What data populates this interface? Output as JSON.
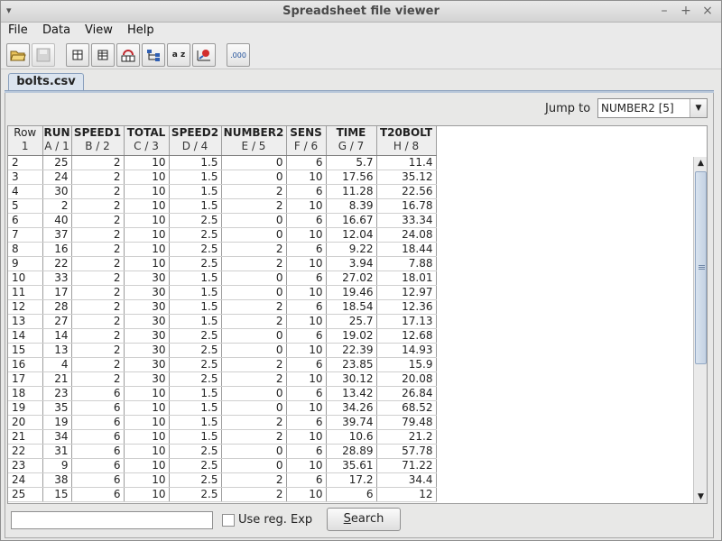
{
  "window": {
    "title": "Spreadsheet file viewer",
    "menu_glyph": "▾",
    "minimize": "–",
    "maximize": "+",
    "close": "×"
  },
  "menu": [
    {
      "label": "File"
    },
    {
      "label": "Data"
    },
    {
      "label": "View"
    },
    {
      "label": "Help"
    }
  ],
  "toolbar": {
    "buttons": [
      "open-folder-icon",
      "save-icon",
      "columns-icon",
      "rows-icon",
      "group-icon",
      "tree-icon",
      "sort-az-icon",
      "chart-icon",
      "decimal-format-icon"
    ],
    "sort_label": "a z",
    "decimal_label": ".000"
  },
  "tab": {
    "label": "bolts.csv"
  },
  "jump": {
    "label_pre": "J",
    "label_rest": "ump to",
    "selected": "NUMBER2 [5]"
  },
  "table": {
    "headers": [
      {
        "name": "Row",
        "sub": "1"
      },
      {
        "name": "RUN",
        "sub": "A / 1"
      },
      {
        "name": "SPEED1",
        "sub": "B / 2"
      },
      {
        "name": "TOTAL",
        "sub": "C / 3"
      },
      {
        "name": "SPEED2",
        "sub": "D / 4"
      },
      {
        "name": "NUMBER2",
        "sub": "E / 5"
      },
      {
        "name": "SENS",
        "sub": "F / 6"
      },
      {
        "name": "TIME",
        "sub": "G / 7"
      },
      {
        "name": "T20BOLT",
        "sub": "H / 8"
      }
    ],
    "rows": [
      [
        "2",
        "25",
        "2",
        "10",
        "1.5",
        "0",
        "6",
        "5.7",
        "11.4"
      ],
      [
        "3",
        "24",
        "2",
        "10",
        "1.5",
        "0",
        "10",
        "17.56",
        "35.12"
      ],
      [
        "4",
        "30",
        "2",
        "10",
        "1.5",
        "2",
        "6",
        "11.28",
        "22.56"
      ],
      [
        "5",
        "2",
        "2",
        "10",
        "1.5",
        "2",
        "10",
        "8.39",
        "16.78"
      ],
      [
        "6",
        "40",
        "2",
        "10",
        "2.5",
        "0",
        "6",
        "16.67",
        "33.34"
      ],
      [
        "7",
        "37",
        "2",
        "10",
        "2.5",
        "0",
        "10",
        "12.04",
        "24.08"
      ],
      [
        "8",
        "16",
        "2",
        "10",
        "2.5",
        "2",
        "6",
        "9.22",
        "18.44"
      ],
      [
        "9",
        "22",
        "2",
        "10",
        "2.5",
        "2",
        "10",
        "3.94",
        "7.88"
      ],
      [
        "10",
        "33",
        "2",
        "30",
        "1.5",
        "0",
        "6",
        "27.02",
        "18.01"
      ],
      [
        "11",
        "17",
        "2",
        "30",
        "1.5",
        "0",
        "10",
        "19.46",
        "12.97"
      ],
      [
        "12",
        "28",
        "2",
        "30",
        "1.5",
        "2",
        "6",
        "18.54",
        "12.36"
      ],
      [
        "13",
        "27",
        "2",
        "30",
        "1.5",
        "2",
        "10",
        "25.7",
        "17.13"
      ],
      [
        "14",
        "14",
        "2",
        "30",
        "2.5",
        "0",
        "6",
        "19.02",
        "12.68"
      ],
      [
        "15",
        "13",
        "2",
        "30",
        "2.5",
        "0",
        "10",
        "22.39",
        "14.93"
      ],
      [
        "16",
        "4",
        "2",
        "30",
        "2.5",
        "2",
        "6",
        "23.85",
        "15.9"
      ],
      [
        "17",
        "21",
        "2",
        "30",
        "2.5",
        "2",
        "10",
        "30.12",
        "20.08"
      ],
      [
        "18",
        "23",
        "6",
        "10",
        "1.5",
        "0",
        "6",
        "13.42",
        "26.84"
      ],
      [
        "19",
        "35",
        "6",
        "10",
        "1.5",
        "0",
        "10",
        "34.26",
        "68.52"
      ],
      [
        "20",
        "19",
        "6",
        "10",
        "1.5",
        "2",
        "6",
        "39.74",
        "79.48"
      ],
      [
        "21",
        "34",
        "6",
        "10",
        "1.5",
        "2",
        "10",
        "10.6",
        "21.2"
      ],
      [
        "22",
        "31",
        "6",
        "10",
        "2.5",
        "0",
        "6",
        "28.89",
        "57.78"
      ],
      [
        "23",
        "9",
        "6",
        "10",
        "2.5",
        "0",
        "10",
        "35.61",
        "71.22"
      ],
      [
        "24",
        "38",
        "6",
        "10",
        "2.5",
        "2",
        "6",
        "17.2",
        "34.4"
      ],
      [
        "25",
        "15",
        "6",
        "10",
        "2.5",
        "2",
        "10",
        "6",
        "12"
      ]
    ]
  },
  "search": {
    "input_value": "",
    "regex_label": "Use reg. Exp",
    "button_u": "S",
    "button_rest": "earch"
  }
}
